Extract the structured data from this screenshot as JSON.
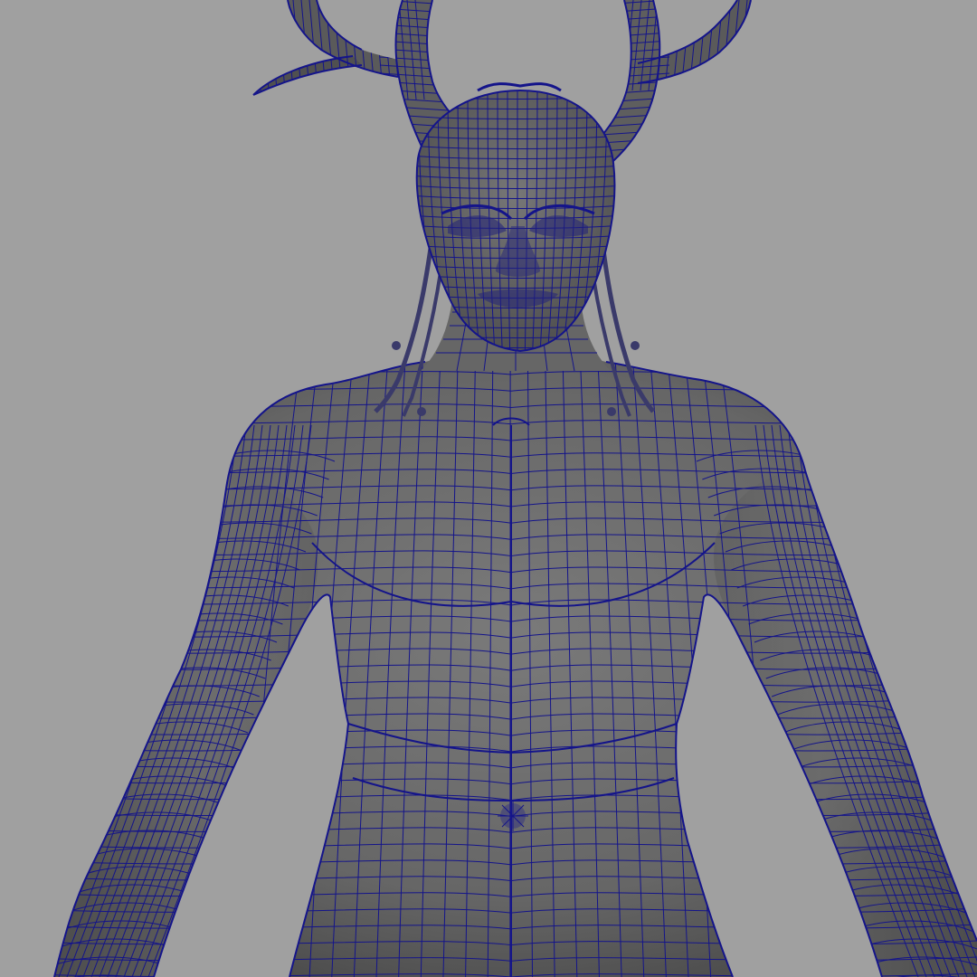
{
  "viewport": {
    "background_color": "#a0a0a0",
    "shaded_color": "#6c6c6c",
    "shaded_shadow_color": "#4a4a4a",
    "wireframe_color": "#14148a"
  },
  "model": {
    "display_mode": "wireframe-on-shaded",
    "parts": [
      "antlers",
      "head",
      "face",
      "hair-braids",
      "neck",
      "torso",
      "left-arm",
      "right-arm",
      "navel",
      "hips"
    ]
  }
}
